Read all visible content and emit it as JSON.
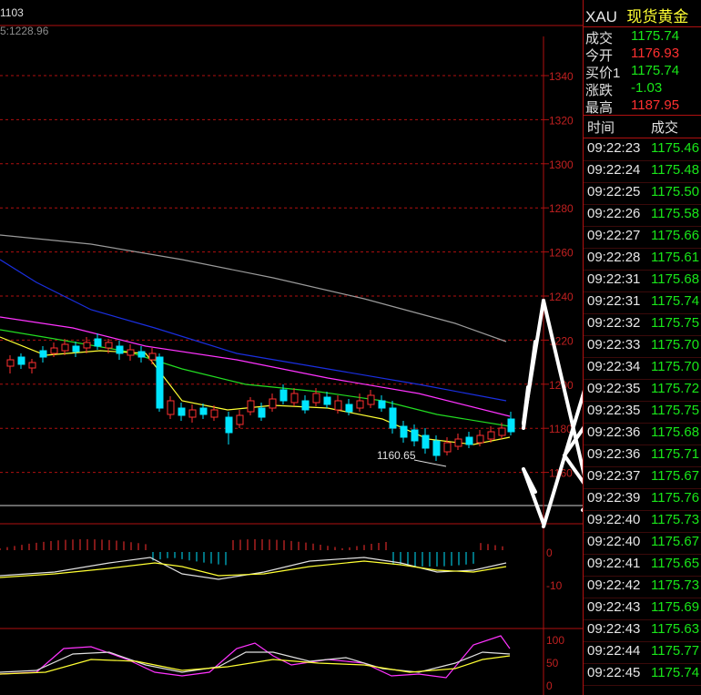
{
  "header": {
    "period_label": "1103",
    "ma_label": "5:1228.96"
  },
  "price_axis": [
    "1340",
    "1320",
    "1300",
    "1280",
    "1260",
    "1240",
    "1220",
    "1200",
    "1180",
    "1160"
  ],
  "low_annotation": "1160.65",
  "macd_axis": [
    "0",
    "-10"
  ],
  "kdj_axis": [
    "100",
    "50",
    "0"
  ],
  "quote": {
    "symbol": "XAU",
    "name": "现货黄金",
    "rows": [
      {
        "label": "成交",
        "value": "1175.74",
        "color": "#19e619"
      },
      {
        "label": "今开",
        "value": "1176.93",
        "color": "#ff3030"
      },
      {
        "label": "买价1",
        "value": "1175.74",
        "color": "#19e619"
      },
      {
        "label": "涨跌",
        "value": "-1.03",
        "color": "#19e619"
      },
      {
        "label": "最高",
        "value": "1187.95",
        "color": "#ff3030"
      }
    ]
  },
  "ticks": {
    "col_time": "时间",
    "col_price": "成交",
    "rows": [
      {
        "time": "09:22:23",
        "price": "1175.46"
      },
      {
        "time": "09:22:24",
        "price": "1175.48"
      },
      {
        "time": "09:22:25",
        "price": "1175.50"
      },
      {
        "time": "09:22:26",
        "price": "1175.58"
      },
      {
        "time": "09:22:27",
        "price": "1175.66"
      },
      {
        "time": "09:22:28",
        "price": "1175.61"
      },
      {
        "time": "09:22:31",
        "price": "1175.68"
      },
      {
        "time": "09:22:31",
        "price": "1175.74"
      },
      {
        "time": "09:22:32",
        "price": "1175.75"
      },
      {
        "time": "09:22:33",
        "price": "1175.70"
      },
      {
        "time": "09:22:34",
        "price": "1175.70"
      },
      {
        "time": "09:22:35",
        "price": "1175.72"
      },
      {
        "time": "09:22:35",
        "price": "1175.75"
      },
      {
        "time": "09:22:36",
        "price": "1175.68"
      },
      {
        "time": "09:22:36",
        "price": "1175.71"
      },
      {
        "time": "09:22:37",
        "price": "1175.67"
      },
      {
        "time": "09:22:39",
        "price": "1175.76"
      },
      {
        "time": "09:22:40",
        "price": "1175.73"
      },
      {
        "time": "09:22:40",
        "price": "1175.67"
      },
      {
        "time": "09:22:41",
        "price": "1175.65"
      },
      {
        "time": "09:22:42",
        "price": "1175.73"
      },
      {
        "time": "09:22:43",
        "price": "1175.69"
      },
      {
        "time": "09:22:43",
        "price": "1175.63"
      },
      {
        "time": "09:22:44",
        "price": "1175.77"
      },
      {
        "time": "09:22:45",
        "price": "1175.74"
      }
    ]
  },
  "colors": {
    "frame": "#b01010",
    "up": "#ff3030",
    "down": "#00e5ff",
    "ma_gray": "#9a9a9a",
    "ma_blue": "#1a2fe0",
    "ma_magenta": "#ff33ff",
    "ma_green": "#22dd22",
    "ma_yellow": "#ffff33"
  }
}
